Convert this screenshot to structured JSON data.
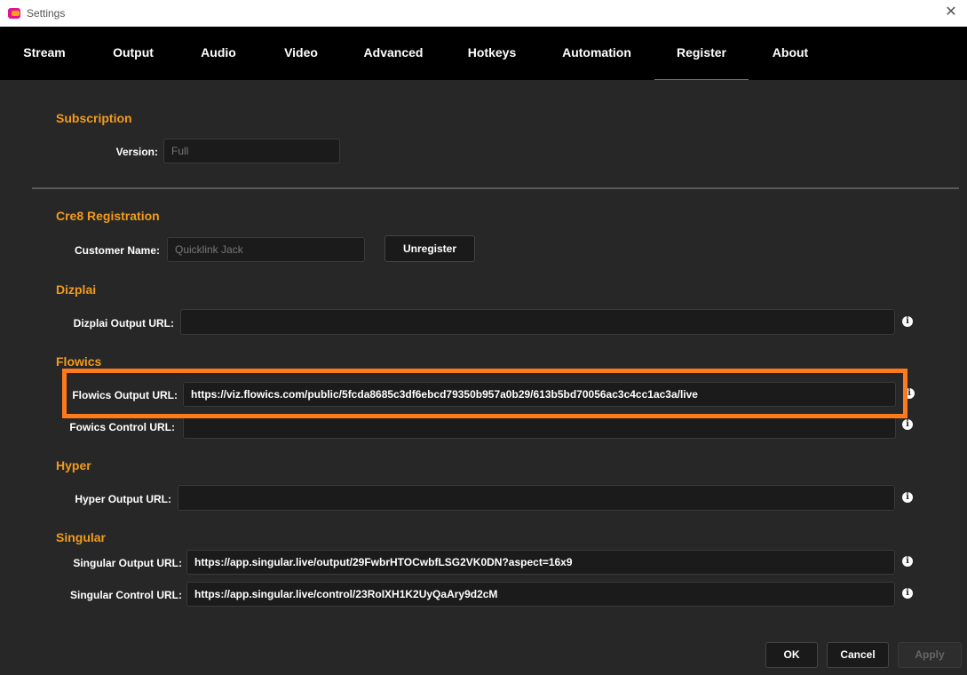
{
  "window": {
    "title": "Settings",
    "close_glyph": "✕",
    "logo_color": "#e0148c"
  },
  "tabs": [
    "Stream",
    "Output",
    "Audio",
    "Video",
    "Advanced",
    "Hotkeys",
    "Automation",
    "Register",
    "About"
  ],
  "active_tab": "Register",
  "subscription": {
    "heading": "Subscription",
    "version_label": "Version:",
    "version_value": "Full"
  },
  "cre8": {
    "heading": "Cre8 Registration",
    "customer_label": "Customer Name:",
    "customer_value": "Quicklink Jack",
    "unregister_label": "Unregister"
  },
  "dizplai": {
    "heading": "Dizplai",
    "output_label": "Dizplai Output URL:",
    "output_value": ""
  },
  "flowics": {
    "heading": "Flowics",
    "output_label": "Flowics Output URL:",
    "output_value": "https://viz.flowics.com/public/5fcda8685c3df6ebcd79350b957a0b29/613b5bd70056ac3c4cc1ac3a/live",
    "control_label": "Fowics Control URL:",
    "control_value": ""
  },
  "hyper": {
    "heading": "Hyper",
    "output_label": "Hyper Output URL:",
    "output_value": ""
  },
  "singular": {
    "heading": "Singular",
    "output_label": "Singular Output URL:",
    "output_value": "https://app.singular.live/output/29FwbrHTOCwbfLSG2VK0DN?aspect=16x9",
    "control_label": "Singular Control URL:",
    "control_value": "https://app.singular.live/control/23RoIXH1K2UyQaAry9d2cM"
  },
  "footer": {
    "ok_label": "OK",
    "cancel_label": "Cancel",
    "apply_label": "Apply"
  },
  "info_glyph": "i",
  "colors": {
    "accent": "#f29b1d",
    "highlight": "#ff7a1a",
    "background": "#272727",
    "tabbar": "#000000"
  }
}
